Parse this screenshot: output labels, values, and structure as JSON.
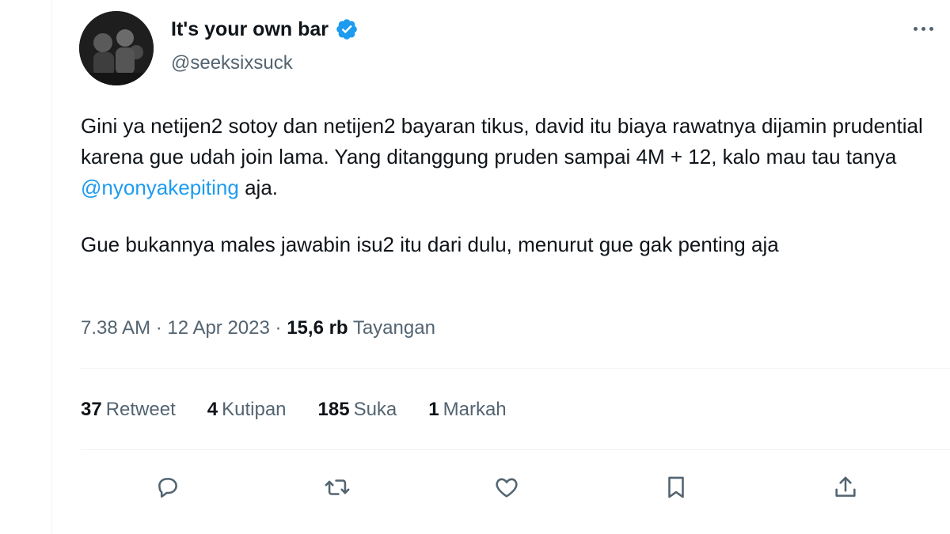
{
  "author": {
    "display_name": "It's your own bar",
    "handle": "@seeksixsuck",
    "verified": true
  },
  "tweet": {
    "paragraph1_a": "Gini ya netijen2 sotoy dan netijen2 bayaran tikus, david itu biaya rawatnya dijamin prudential karena gue udah join lama. Yang ditanggung pruden sampai 4M + 12, kalo mau tau tanya ",
    "mention": "@nyonyakepiting",
    "paragraph1_b": " aja.",
    "paragraph2": "Gue bukannya males jawabin isu2 itu dari dulu, menurut gue gak penting aja"
  },
  "meta": {
    "time": "7.38 AM",
    "separator": "·",
    "date": "12 Apr 2023",
    "views_count": "15,6 rb",
    "views_label": "Tayangan"
  },
  "stats": {
    "retweets_count": "37",
    "retweets_label": "Retweet",
    "quotes_count": "4",
    "quotes_label": "Kutipan",
    "likes_count": "185",
    "likes_label": "Suka",
    "bookmarks_count": "1",
    "bookmarks_label": "Markah"
  },
  "colors": {
    "text": "#0f1419",
    "secondary": "#536471",
    "accent": "#1d9bf0",
    "divider": "#eff3f4"
  },
  "icons": [
    "verified-badge-icon",
    "more-icon",
    "reply-icon",
    "retweet-icon",
    "like-icon",
    "bookmark-icon",
    "share-icon"
  ]
}
